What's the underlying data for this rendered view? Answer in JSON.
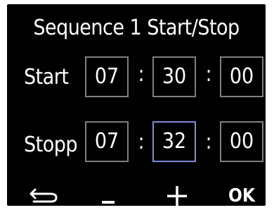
{
  "title": "Sequence 1 Start/Stop",
  "start": {
    "label": "Start",
    "hour": "07",
    "minute": "30",
    "second": "00"
  },
  "stop": {
    "label": "Stopp",
    "hour": "07",
    "minute": "32",
    "second": "00",
    "selected_field": "minute"
  },
  "separator": ":",
  "softkeys": {
    "back_icon": "return-arrow-icon",
    "minus_icon": "minus-icon",
    "plus_icon": "plus-icon",
    "ok_label": "OK"
  },
  "colors": {
    "background": "#000000",
    "text": "#ffffff",
    "field_border": "#7f7f7f",
    "selected_border": "#7e8bd8"
  }
}
